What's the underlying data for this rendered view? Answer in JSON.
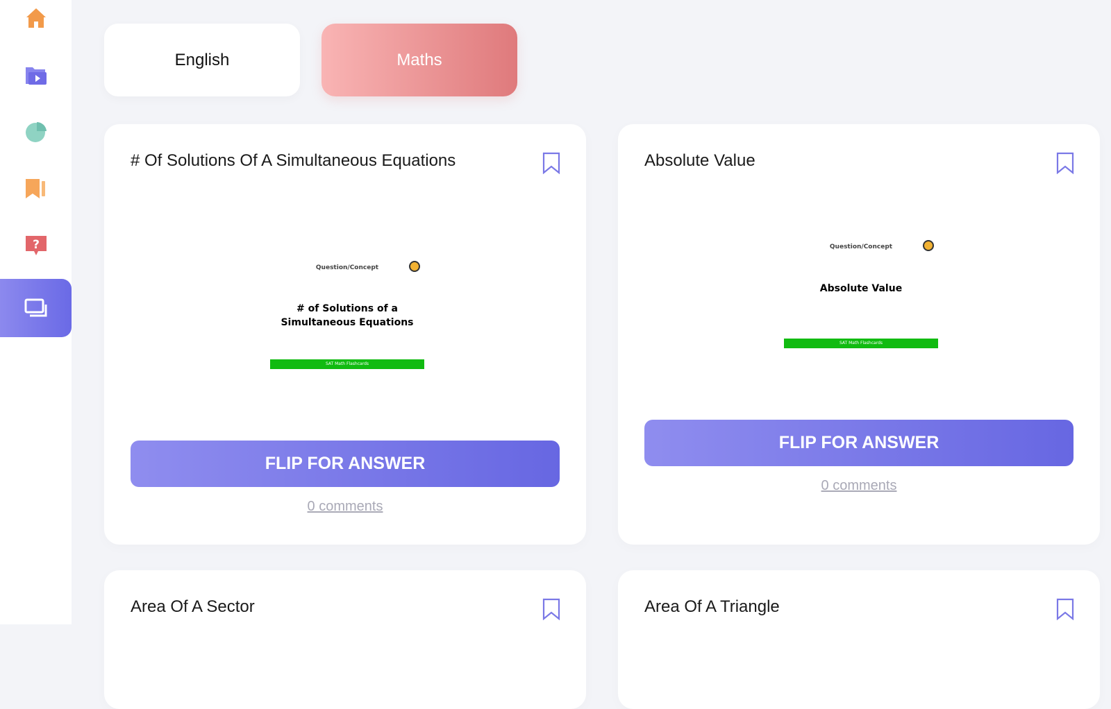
{
  "sidebar": {
    "items": [
      {
        "name": "home-icon",
        "color": "#f29a4a"
      },
      {
        "name": "video-folder-icon",
        "color": "#6f6be6"
      },
      {
        "name": "pie-chart-icon",
        "color": "#7bc7b7"
      },
      {
        "name": "bookmark-book-icon",
        "color": "#f6a65a"
      },
      {
        "name": "question-icon",
        "color": "#e2666a"
      },
      {
        "name": "flashcards-icon",
        "color": "#ffffff",
        "active": true
      }
    ]
  },
  "tabs": [
    {
      "label": "English",
      "selected": false
    },
    {
      "label": "Maths",
      "selected": true
    }
  ],
  "cards": [
    {
      "title": "# Of Solutions Of A Simultaneous Equations",
      "preview_label": "Question/Concept",
      "preview_title": "# of Solutions of a Simultaneous Equations",
      "preview_footer": "SAT Math Flashcards",
      "button": "FLIP FOR ANSWER",
      "comments": "0 comments"
    },
    {
      "title": "Absolute Value",
      "preview_label": "Question/Concept",
      "preview_title": "Absolute Value",
      "preview_footer": "SAT Math Flashcards",
      "button": "FLIP FOR ANSWER",
      "comments": "0 comments"
    },
    {
      "title": "Area Of A Sector"
    },
    {
      "title": "Area Of A Triangle"
    }
  ],
  "colors": {
    "accent": "#6a6ae6",
    "maths_tab_start": "#f9b4b4",
    "maths_tab_end": "#df7a7c",
    "preview_bar": "#11bb11"
  }
}
